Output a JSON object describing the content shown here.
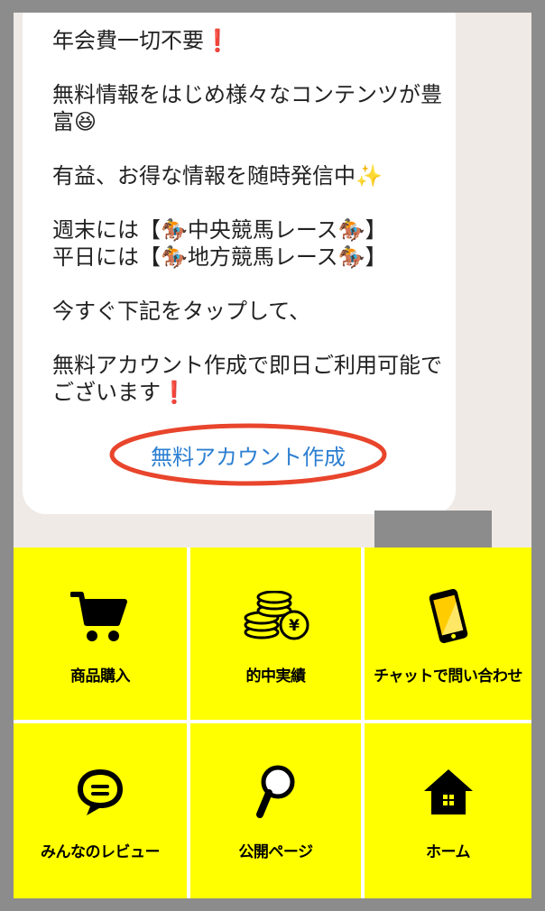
{
  "chat": {
    "message": "年会費一切不要❗\n\n無料情報をはじめ様々なコンテンツが豊富😆\n\n有益、お得な情報を随時発信中✨\n\n週末には【🏇中央競馬レース🏇】\n平日には【🏇地方競馬レース🏇】\n\n今すぐ下記をタップして、\n\n無料アカウント作成で即日ご利用可能でございます❗",
    "link_label": "無料アカウント作成",
    "link_color": "#2c7fd1",
    "highlight_color": "#e8452c"
  },
  "menu": {
    "background": "#ffff00",
    "items": [
      {
        "label": "商品購入",
        "icon": "cart-icon"
      },
      {
        "label": "的中実績",
        "icon": "coins-yen-icon"
      },
      {
        "label": "チャットで問い合わせ",
        "icon": "smartphone-icon"
      },
      {
        "label": "みんなのレビュー",
        "icon": "speech-bubble-icon"
      },
      {
        "label": "公開ページ",
        "icon": "magnifier-icon"
      },
      {
        "label": "ホーム",
        "icon": "home-icon"
      }
    ]
  }
}
